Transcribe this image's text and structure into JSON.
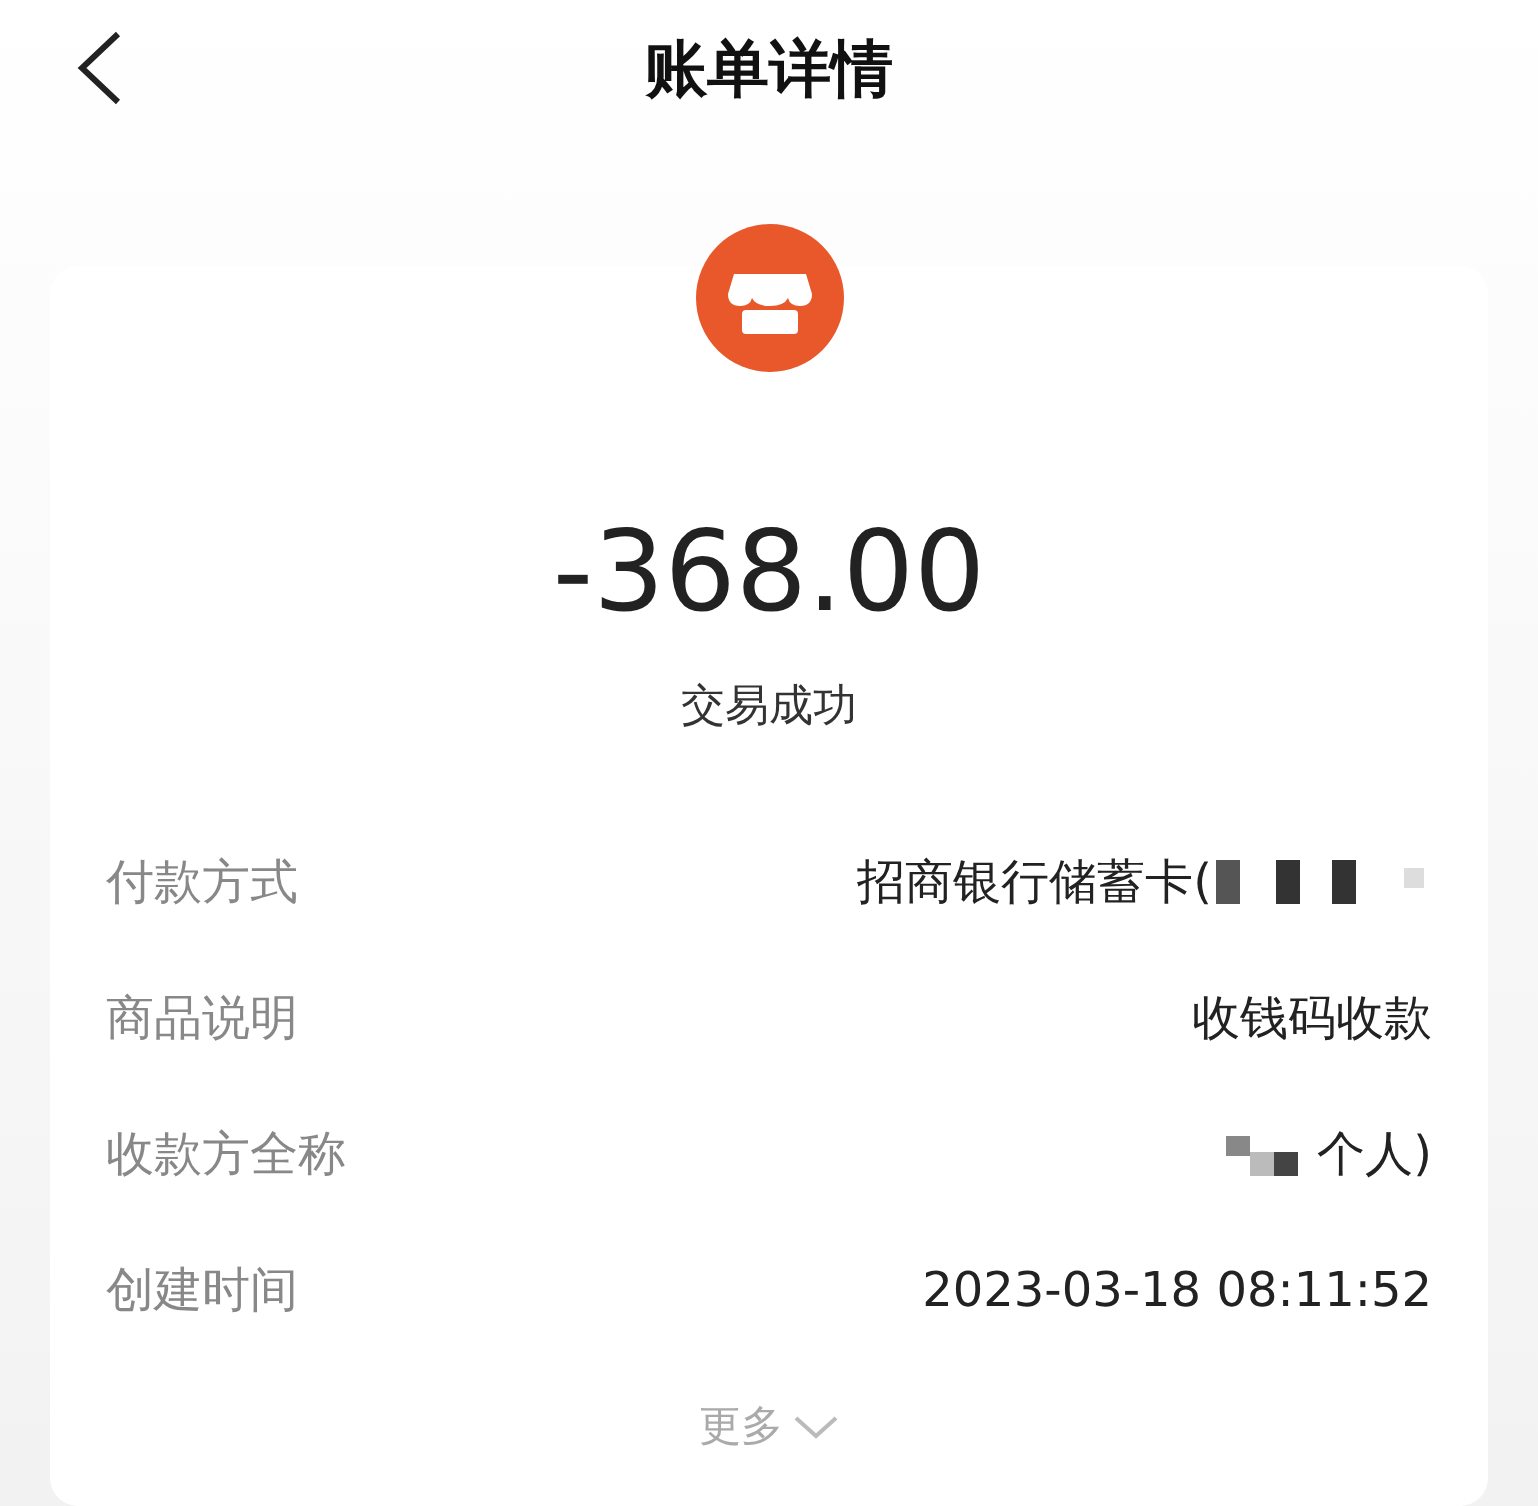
{
  "header": {
    "title": "账单详情"
  },
  "bill": {
    "amount": "-368.00",
    "status": "交易成功"
  },
  "rows": [
    {
      "label": "付款方式",
      "value": "招商银行储蓄卡(",
      "masked_before": false,
      "masked_after": true
    },
    {
      "label": "商品说明",
      "value": "收钱码收款",
      "masked_before": false,
      "masked_after": false
    },
    {
      "label": "收款方全称",
      "value": "个人)",
      "masked_before": true,
      "masked_after": false
    },
    {
      "label": "创建时间",
      "value": "2023-03-18 08:11:52",
      "masked_before": false,
      "masked_after": false
    }
  ],
  "more": {
    "label": "更多"
  }
}
